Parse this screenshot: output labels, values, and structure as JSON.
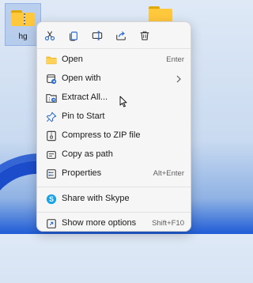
{
  "desktop": {
    "icon_label": "hg"
  },
  "toolbar": {
    "buttons": [
      {
        "icon": "cut-icon"
      },
      {
        "icon": "copy-icon"
      },
      {
        "icon": "rename-icon"
      },
      {
        "icon": "share-icon"
      },
      {
        "icon": "delete-icon"
      }
    ]
  },
  "menu": {
    "items": [
      {
        "label": "Open",
        "shortcut": "Enter",
        "icon": "folder-icon"
      },
      {
        "label": "Open with",
        "shortcut": "",
        "icon": "open-with-icon",
        "submenu": true
      },
      {
        "label": "Extract All...",
        "shortcut": "",
        "icon": "extract-icon"
      },
      {
        "label": "Pin to Start",
        "shortcut": "",
        "icon": "pin-icon"
      },
      {
        "label": "Compress to ZIP file",
        "shortcut": "",
        "icon": "zip-icon"
      },
      {
        "label": "Copy as path",
        "shortcut": "",
        "icon": "copy-path-icon"
      },
      {
        "label": "Properties",
        "shortcut": "Alt+Enter",
        "icon": "properties-icon"
      },
      {
        "label": "Share with Skype",
        "shortcut": "",
        "icon": "skype-icon"
      },
      {
        "label": "Show more options",
        "shortcut": "Shift+F10",
        "icon": "more-options-icon"
      }
    ]
  },
  "colors": {
    "accent": "#3a6fd8",
    "folder": "#ffc83d",
    "menu_bg": "#f6f6f7"
  }
}
